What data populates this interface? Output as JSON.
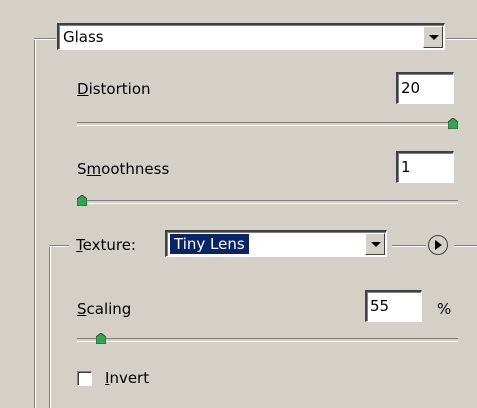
{
  "filter": {
    "selected": "Glass"
  },
  "distortion": {
    "label_mnemonic": "D",
    "label_rest": "istortion",
    "value": "20",
    "slider_fraction": 1.0
  },
  "smoothness": {
    "label_pre": "S",
    "label_mnemonic": "m",
    "label_rest": "oothness",
    "value": "1",
    "slider_fraction": 0.0
  },
  "texture": {
    "label_mnemonic": "T",
    "label_rest": "exture:",
    "selected": "Tiny Lens"
  },
  "scaling": {
    "label_mnemonic": "S",
    "label_rest": "caling",
    "value": "55",
    "unit": "%",
    "slider_fraction": 0.05
  },
  "invert": {
    "label_mnemonic": "I",
    "label_rest": "nvert",
    "checked": false
  },
  "colors": {
    "panel": "#d4d0c8",
    "selection": "#0a246a",
    "thumb": "#2fa84f"
  },
  "icons": {
    "dropdown": "chevron-down-icon",
    "menu": "play-circle-icon",
    "thumb": "slider-thumb-icon"
  }
}
